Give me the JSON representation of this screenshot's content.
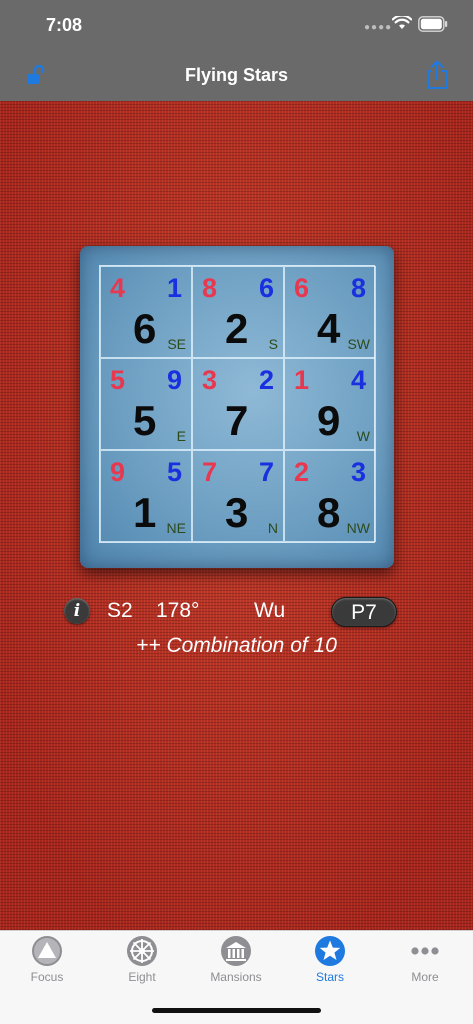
{
  "status": {
    "time": "7:08"
  },
  "nav": {
    "title": "Flying Stars"
  },
  "chart": {
    "cells": [
      {
        "mountain": "4",
        "water": "1",
        "period": "6",
        "direction": "SE"
      },
      {
        "mountain": "8",
        "water": "6",
        "period": "2",
        "direction": "S"
      },
      {
        "mountain": "6",
        "water": "8",
        "period": "4",
        "direction": "SW"
      },
      {
        "mountain": "5",
        "water": "9",
        "period": "5",
        "direction": "E"
      },
      {
        "mountain": "3",
        "water": "2",
        "period": "7",
        "direction": ""
      },
      {
        "mountain": "1",
        "water": "4",
        "period": "9",
        "direction": "W"
      },
      {
        "mountain": "9",
        "water": "5",
        "period": "1",
        "direction": "NE"
      },
      {
        "mountain": "7",
        "water": "7",
        "period": "3",
        "direction": "N"
      },
      {
        "mountain": "2",
        "water": "3",
        "period": "8",
        "direction": "NW"
      }
    ],
    "colors": {
      "mountain": "#e8384f",
      "water": "#1a2fe0",
      "period": "#0b0b0b"
    }
  },
  "info": {
    "info_glyph": "i",
    "sector": "S2",
    "degree": "178°",
    "mountain_name": "Wu",
    "period_button": "P7",
    "combination": "++ Combination of 10"
  },
  "tabs": [
    {
      "label": "Focus",
      "icon": "focus-icon",
      "active": false
    },
    {
      "label": "Eight",
      "icon": "eight-icon",
      "active": false
    },
    {
      "label": "Mansions",
      "icon": "mansions-icon",
      "active": false
    },
    {
      "label": "Stars",
      "icon": "stars-icon",
      "active": true
    },
    {
      "label": "More",
      "icon": "more-icon",
      "active": false
    }
  ],
  "theme": {
    "accent": "#1f7ae0",
    "nav_bg": "#6a6a6a",
    "fabric": "#b3281c",
    "card": "#6d9fc2"
  }
}
